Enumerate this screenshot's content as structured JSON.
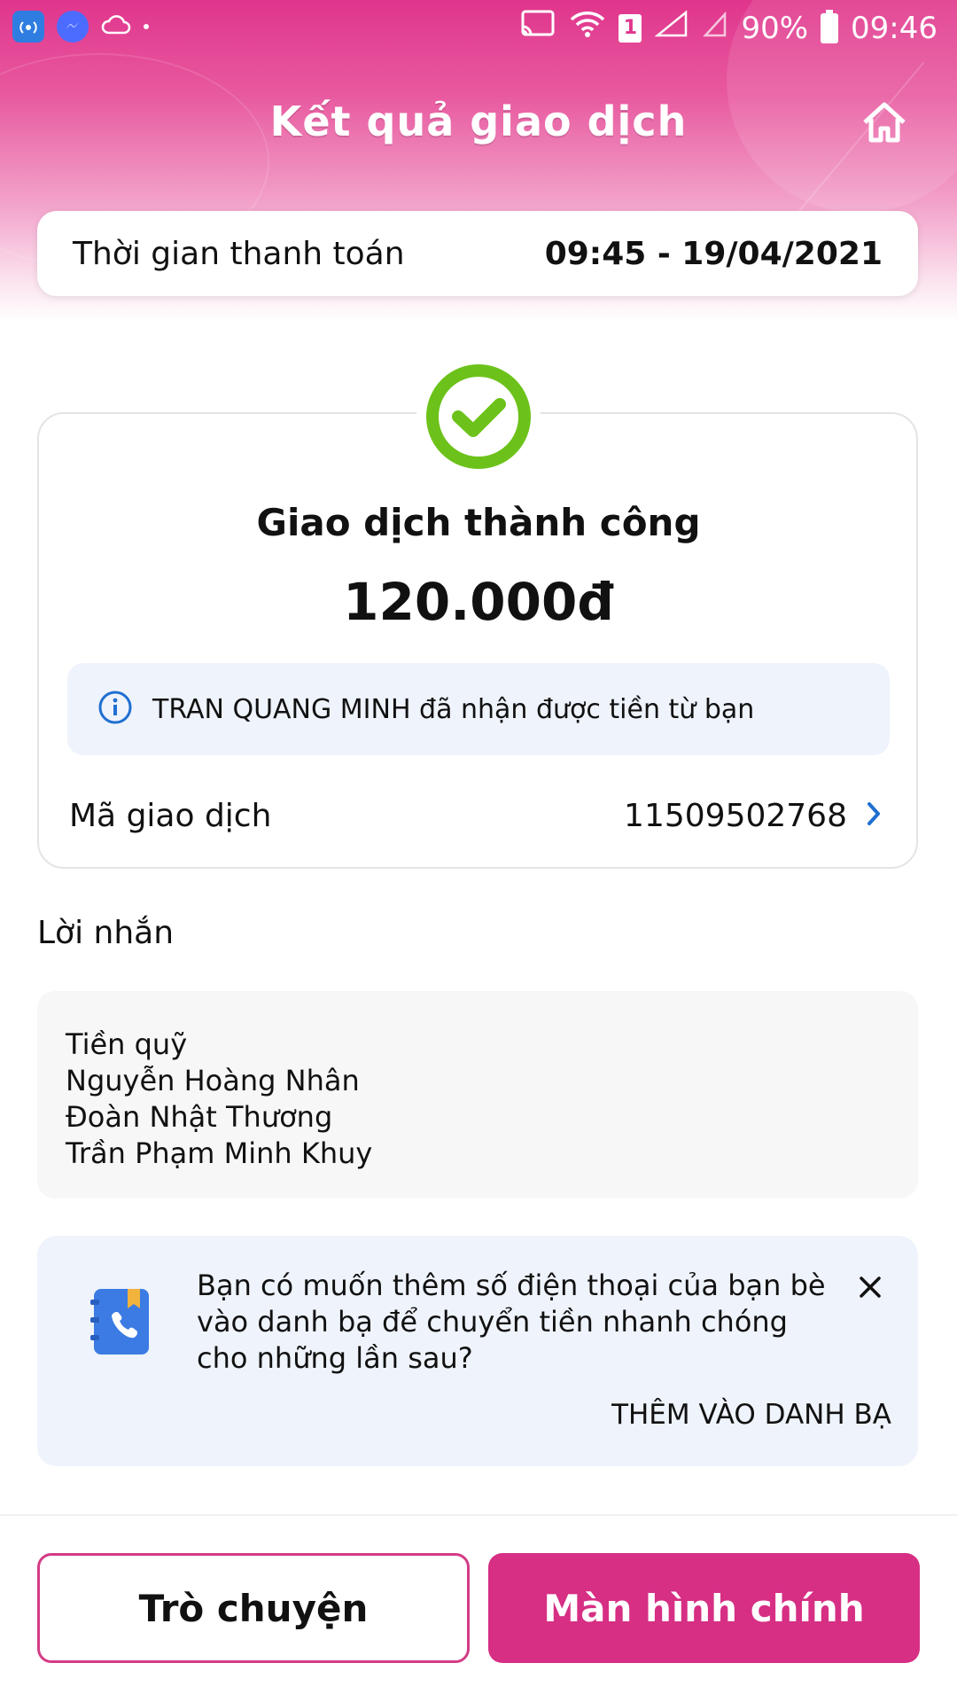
{
  "status_bar": {
    "battery": "90%",
    "time": "09:46",
    "sim_slot": "1"
  },
  "header": {
    "title": "Kết quả giao dịch"
  },
  "payment_time": {
    "label": "Thời gian thanh toán",
    "value": "09:45 - 19/04/2021"
  },
  "result": {
    "status": "Giao dịch thành công",
    "amount": "120.000đ",
    "info": "TRAN QUANG MINH đã nhận được tiền từ bạn",
    "txn_label": "Mã giao dịch",
    "txn_id": "11509502768"
  },
  "message": {
    "title": "Lời nhắn",
    "lines": [
      "Tiền quỹ",
      "Nguyễn Hoàng Nhân",
      "Đoàn Nhật Thương",
      "Trần Phạm Minh Khuy"
    ]
  },
  "contact_prompt": {
    "text": "Bạn có muốn thêm số điện thoại của bạn bè vào danh bạ để chuyển tiền nhanh chóng cho những lần sau?",
    "action": "THÊM VÀO DANH BẠ"
  },
  "buttons": {
    "chat": "Trò chuyện",
    "home": "Màn hình chính"
  },
  "colors": {
    "brand": "#d62f84",
    "success": "#6cc21a",
    "info": "#1f6fd1"
  }
}
